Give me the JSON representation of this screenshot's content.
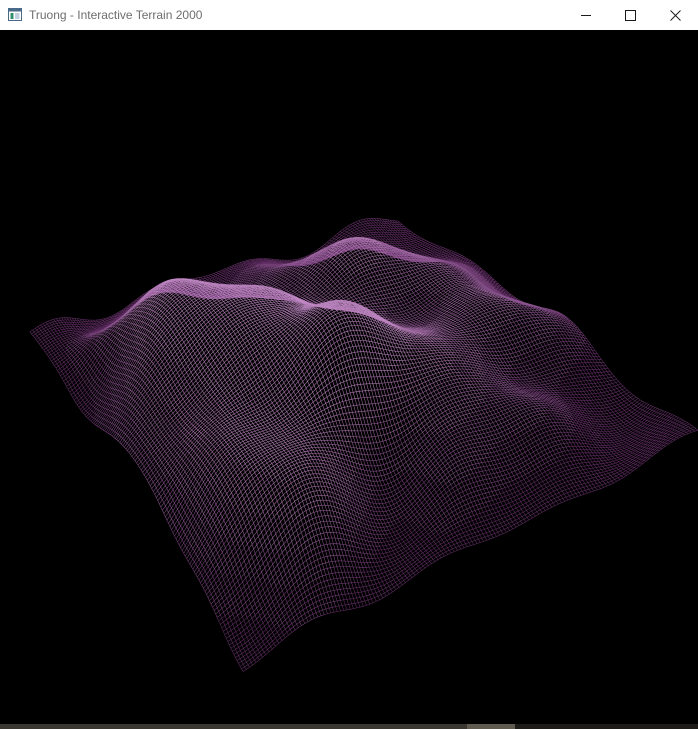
{
  "window": {
    "title": "Truong - Interactive Terrain 2000",
    "icon": "app-window-icon",
    "controls": {
      "minimize": "minimize-icon",
      "maximize": "maximize-icon",
      "close": "close-icon"
    }
  },
  "scene": {
    "render_mode": "wireframe",
    "background_color": "#000000",
    "wire_color_dark": "#5a1a5e",
    "wire_color_light": "#e8a8ec",
    "grid_resolution": 140
  },
  "colors": {
    "titlebar_bg": "#ffffff",
    "title_text": "#6e6e6e",
    "control_glyph": "#1a1a1a"
  }
}
